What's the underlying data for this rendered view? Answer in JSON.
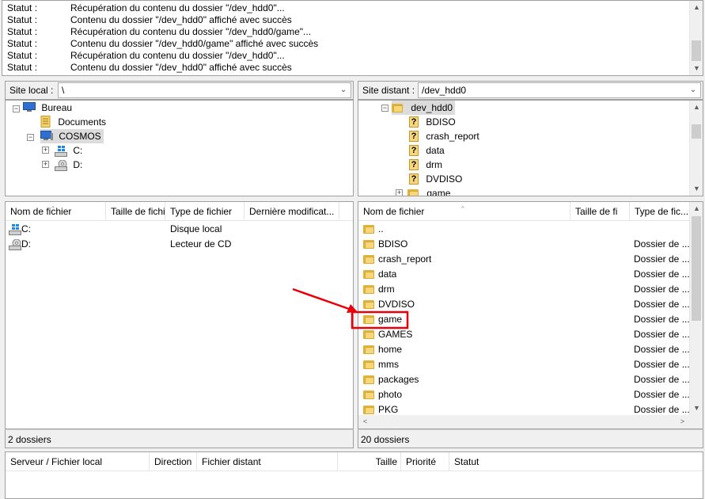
{
  "log": {
    "rows": [
      {
        "label": "Statut :",
        "text": "Récupération du contenu du dossier \"/dev_hdd0\"..."
      },
      {
        "label": "Statut :",
        "text": "Contenu du dossier \"/dev_hdd0\" affiché avec succès"
      },
      {
        "label": "Statut :",
        "text": "Récupération du contenu du dossier \"/dev_hdd0/game\"..."
      },
      {
        "label": "Statut :",
        "text": "Contenu du dossier \"/dev_hdd0/game\" affiché avec succès"
      },
      {
        "label": "Statut :",
        "text": "Récupération du contenu du dossier \"/dev_hdd0\"..."
      },
      {
        "label": "Statut :",
        "text": "Contenu du dossier \"/dev_hdd0\" affiché avec succès"
      }
    ]
  },
  "local": {
    "site_label": "Site local :",
    "path": "\\",
    "tree": [
      {
        "label": "Bureau",
        "icon": "desktop-icon"
      },
      {
        "label": "Documents",
        "icon": "documents-icon"
      },
      {
        "label": "COSMOS",
        "icon": "computer-icon"
      },
      {
        "label": "C:",
        "icon": "windows-drive-icon"
      },
      {
        "label": "D:",
        "icon": "cd-drive-icon"
      }
    ],
    "columns": [
      "Nom de fichier",
      "Taille de fichier",
      "Type de fichier",
      "Dernière modification"
    ],
    "columns_visible": [
      "Nom de fichier",
      "Taille de fichi",
      "Type de fichier",
      "Dernière modificat..."
    ],
    "files": [
      {
        "name": "C:",
        "size": "",
        "type": "Disque local",
        "icon": "windows-drive-icon"
      },
      {
        "name": "D:",
        "size": "",
        "type": "Lecteur de CD",
        "icon": "cd-drive-icon"
      }
    ],
    "status": "2 dossiers"
  },
  "remote": {
    "site_label": "Site distant :",
    "path": "/dev_hdd0",
    "tree": [
      {
        "label": "dev_hdd0",
        "icon": "folder-open-icon"
      },
      {
        "label": "BDISO",
        "icon": "unknown-folder-icon"
      },
      {
        "label": "crash_report",
        "icon": "unknown-folder-icon"
      },
      {
        "label": "data",
        "icon": "unknown-folder-icon"
      },
      {
        "label": "drm",
        "icon": "unknown-folder-icon"
      },
      {
        "label": "DVDISO",
        "icon": "unknown-folder-icon"
      },
      {
        "label": "game",
        "icon": "folder-icon"
      }
    ],
    "columns_visible": [
      "Nom de fichier",
      "Taille de fi",
      "Type de fic..."
    ],
    "files": [
      {
        "name": "..",
        "type": ""
      },
      {
        "name": "BDISO",
        "type": "Dossier de ..."
      },
      {
        "name": "crash_report",
        "type": "Dossier de ..."
      },
      {
        "name": "data",
        "type": "Dossier de ..."
      },
      {
        "name": "drm",
        "type": "Dossier de ..."
      },
      {
        "name": "DVDISO",
        "type": "Dossier de ..."
      },
      {
        "name": "game",
        "type": "Dossier de ..."
      },
      {
        "name": "GAMES",
        "type": "Dossier de ..."
      },
      {
        "name": "home",
        "type": "Dossier de ..."
      },
      {
        "name": "mms",
        "type": "Dossier de ..."
      },
      {
        "name": "packages",
        "type": "Dossier de ..."
      },
      {
        "name": "photo",
        "type": "Dossier de ..."
      },
      {
        "name": "PKG",
        "type": "Dossier de ..."
      }
    ],
    "status": "20 dossiers",
    "highlight_color": "#e8000b"
  },
  "queue": {
    "columns": [
      "Serveur / Fichier local",
      "Direction",
      "Fichier distant",
      "Taille",
      "Priorité",
      "Statut"
    ]
  }
}
